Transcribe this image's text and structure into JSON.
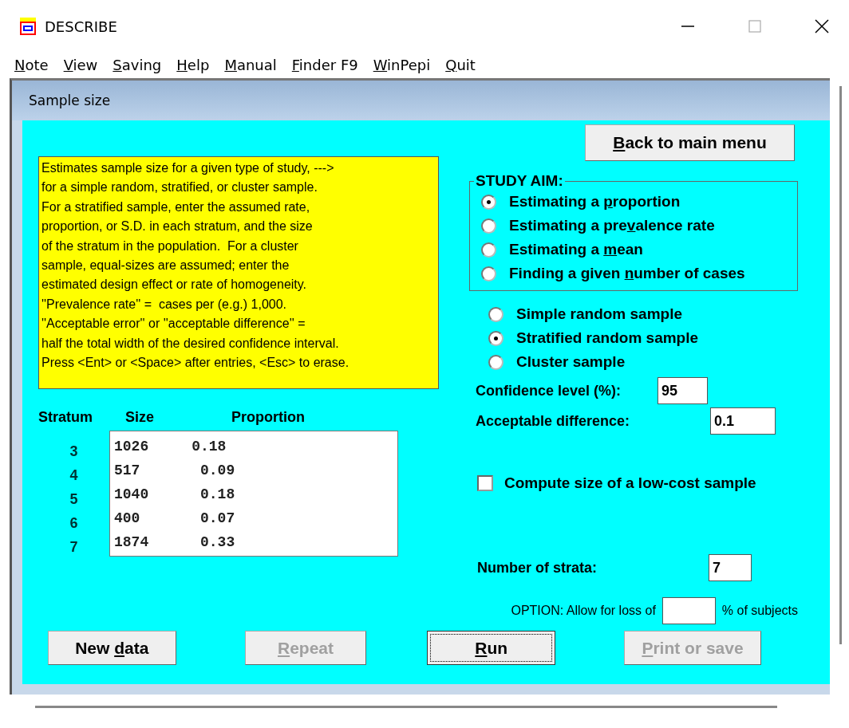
{
  "window": {
    "title": "DESCRIBE"
  },
  "menu": [
    {
      "key": "N",
      "post": "ote"
    },
    {
      "key": "V",
      "post": "iew"
    },
    {
      "key": "S",
      "post": "aving"
    },
    {
      "key": "H",
      "post": "elp"
    },
    {
      "key": "M",
      "post": "anual"
    },
    {
      "key": "F",
      "post": "inder F9"
    },
    {
      "key": "W",
      "post": "inPepi"
    },
    {
      "key": "Q",
      "post": "uit"
    }
  ],
  "panel": {
    "title": "Sample size"
  },
  "description": [
    "Estimates sample size for a given type of study, --->",
    "for a simple random, stratified, or cluster sample.",
    "For a stratified sample, enter the assumed rate,",
    "proportion, or S.D. in each stratum, and the size",
    "of the stratum in the population.  For a cluster",
    "sample, equal-sizes are assumed; enter the",
    "estimated design effect or rate of homogeneity.",
    "''Prevalence rate'' =  cases per (e.g.) 1,000.",
    "''Acceptable error'' or ''acceptable difference'' =",
    "half the total width of the desired confidence interval.",
    "Press <Ent> or <Space> after entries, <Esc> to erase."
  ],
  "table": {
    "columns": [
      "Stratum",
      "Size",
      "Proportion"
    ],
    "rows": [
      {
        "stratum": "3",
        "line": "1026     0.18"
      },
      {
        "stratum": "4",
        "line": "517       0.09"
      },
      {
        "stratum": "5",
        "line": "1040      0.18"
      },
      {
        "stratum": "6",
        "line": "400       0.07"
      },
      {
        "stratum": "7",
        "line": "1874      0.33"
      }
    ]
  },
  "back_button": {
    "key": "B",
    "post": "ack to main menu"
  },
  "study_aim": {
    "title": "STUDY AIM:",
    "options": [
      {
        "pre": "Estimating a ",
        "key": "p",
        "post": "roportion",
        "selected": true
      },
      {
        "pre": "Estimating a pre",
        "key": "v",
        "post": "alence rate",
        "selected": false
      },
      {
        "pre": "Estimating a ",
        "key": "m",
        "post": "ean",
        "selected": false
      },
      {
        "pre": "Finding a given ",
        "key": "n",
        "post": "umber of cases",
        "selected": false
      }
    ]
  },
  "sample_types": [
    {
      "label": "Simple random sample",
      "selected": false
    },
    {
      "label": "Stratified random sample",
      "selected": true
    },
    {
      "label": "Cluster sample",
      "selected": false
    }
  ],
  "confidence_level": {
    "label": "Confidence level (%):",
    "value": "95"
  },
  "acceptable_difference": {
    "label": "Acceptable difference:",
    "value": "0.1"
  },
  "low_cost": {
    "label": "Compute size of a low-cost sample",
    "checked": false
  },
  "number_of_strata": {
    "label": "Number of strata:",
    "value": "7"
  },
  "loss_option": {
    "label": "OPTION:  Allow for loss of",
    "suffix": "% of subjects"
  },
  "buttons": [
    {
      "pre": "New ",
      "key": "d",
      "post": "ata",
      "disabled": false,
      "focused": false
    },
    {
      "key": "R",
      "post": "epeat",
      "disabled": true,
      "focused": false
    },
    {
      "key": "R",
      "post": "un",
      "disabled": false,
      "focused": true
    },
    {
      "key": "P",
      "post": "rint or save",
      "disabled": true,
      "focused": false
    }
  ]
}
